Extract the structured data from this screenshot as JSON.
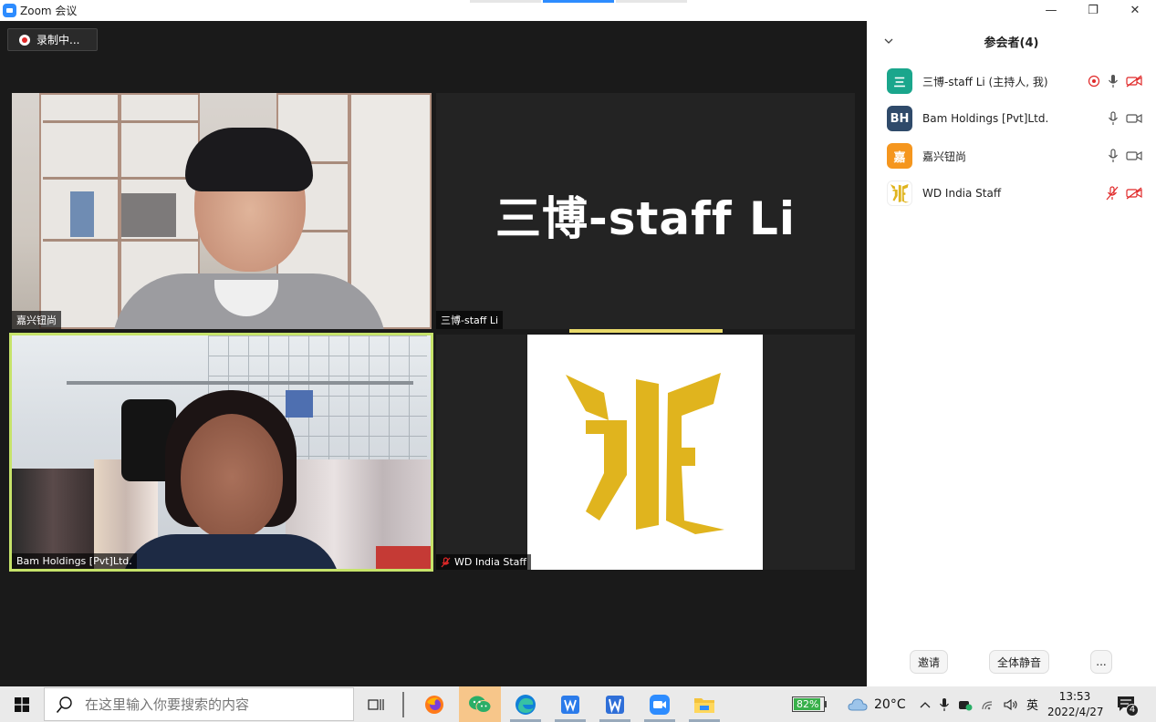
{
  "window": {
    "title": "Zoom 会议",
    "controls": {
      "minimize": "—",
      "restore": "❐",
      "close": "✕"
    }
  },
  "recording": {
    "label": "录制中..."
  },
  "tiles": [
    {
      "name": "嘉兴钮尚"
    },
    {
      "name": "三博-staff Li",
      "display_text": "三博-staff Li"
    },
    {
      "name": "Bam Holdings [Pvt]Ltd."
    },
    {
      "name": "WD India Staff",
      "logo_text": "浙"
    }
  ],
  "sidebar": {
    "title": "参会者(4)",
    "participants": [
      {
        "avatar": "三",
        "avatar_color": "#1aa68c",
        "name": "三博-staff Li (主持人, 我)",
        "recording": true,
        "mic": "on",
        "video": "off"
      },
      {
        "avatar": "BH",
        "avatar_color": "#2f4a6a",
        "name": "Bam Holdings [Pvt]Ltd.",
        "recording": false,
        "mic": "on",
        "video": "on"
      },
      {
        "avatar": "嘉",
        "avatar_color": "#f5961e",
        "name": "嘉兴钮尚",
        "recording": false,
        "mic": "on",
        "video": "on"
      },
      {
        "avatar": "浙",
        "avatar_color": "#ffffff",
        "name": "WD India Staff",
        "recording": false,
        "mic": "off",
        "video": "off"
      }
    ],
    "footer": {
      "invite": "邀请",
      "mute_all": "全体静音",
      "more": "..."
    }
  },
  "taskbar": {
    "search_placeholder": "在这里输入你要搜索的内容",
    "battery": "82%",
    "weather": "20°C",
    "ime": "英",
    "time": "13:53",
    "date": "2022/4/27",
    "notifications": "4"
  },
  "colors": {
    "active_speaker_border": "#c6e36a",
    "muted_red": "#e02828",
    "zoom_blue": "#2d8cff",
    "logo_gold": "#e0b41e"
  }
}
